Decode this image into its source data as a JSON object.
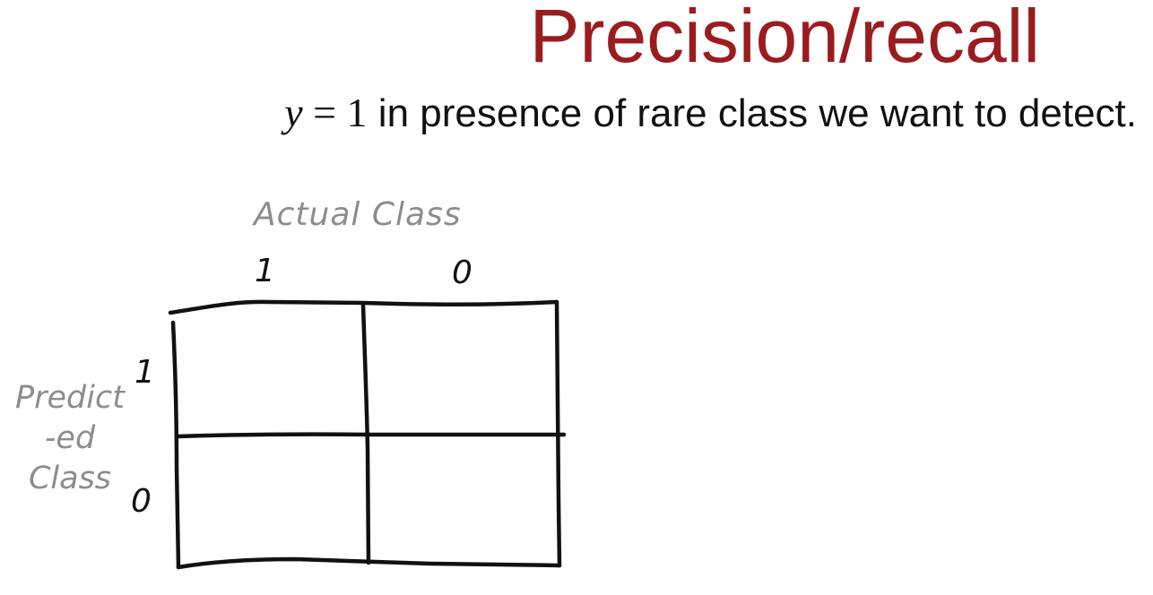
{
  "title": "Precision/recall",
  "subtitle": {
    "math_var": "y",
    "math_rest": " = 1",
    "text": " in presence of rare class we want to detect."
  },
  "matrix": {
    "actual_label": "Actual Class",
    "actual_values": [
      "1",
      "0"
    ],
    "predicted_label_lines": [
      "Predict",
      "-ed",
      "Class"
    ],
    "predicted_values": [
      "1",
      "0"
    ]
  },
  "colors": {
    "title": "#9b1c1f",
    "handwriting_gray": "#8d8d8d",
    "ink": "#111111"
  }
}
